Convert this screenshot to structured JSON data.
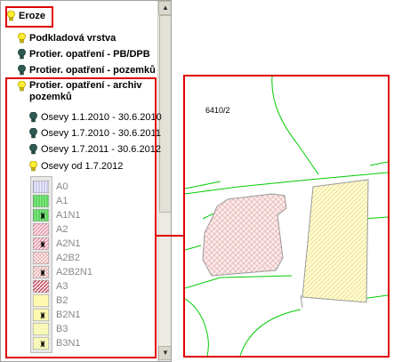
{
  "tree": {
    "root_label": "Eroze",
    "items": [
      {
        "label": "Podkladová vrstva",
        "bulb": "yellow",
        "bold": true
      },
      {
        "label": "Protier. opatření - PB/DPB",
        "bulb": "dark",
        "bold": true
      },
      {
        "label": "Protier. opatření - pozemků",
        "bulb": "dark",
        "bold": true
      },
      {
        "label": "Protier. opatření - archiv pozemků",
        "bulb": "yellow",
        "bold": true
      }
    ],
    "subitems": [
      {
        "label": "Osevy 1.1.2010 - 30.6.2010",
        "bulb": "dark"
      },
      {
        "label": "Osevy 1.7.2010 - 30.6.2011",
        "bulb": "dark"
      },
      {
        "label": "Osevy 1.7.2011 - 30.6.2012",
        "bulb": "dark"
      },
      {
        "label": "Osevy od 1.7.2012",
        "bulb": "yellow"
      }
    ]
  },
  "legend": [
    "A0",
    "A1",
    "A1N1",
    "A2",
    "A2N1",
    "A2B2",
    "A2B2N1",
    "A3",
    "B2",
    "B2N1",
    "B3",
    "B3N1"
  ],
  "map": {
    "parcel_label": "6410/2"
  },
  "colors": {
    "highlight_border": "#e00000",
    "parcel_lines": "#00cc00",
    "bulb_yellow": "#ffee33",
    "bulb_dark": "#2e5c55"
  }
}
